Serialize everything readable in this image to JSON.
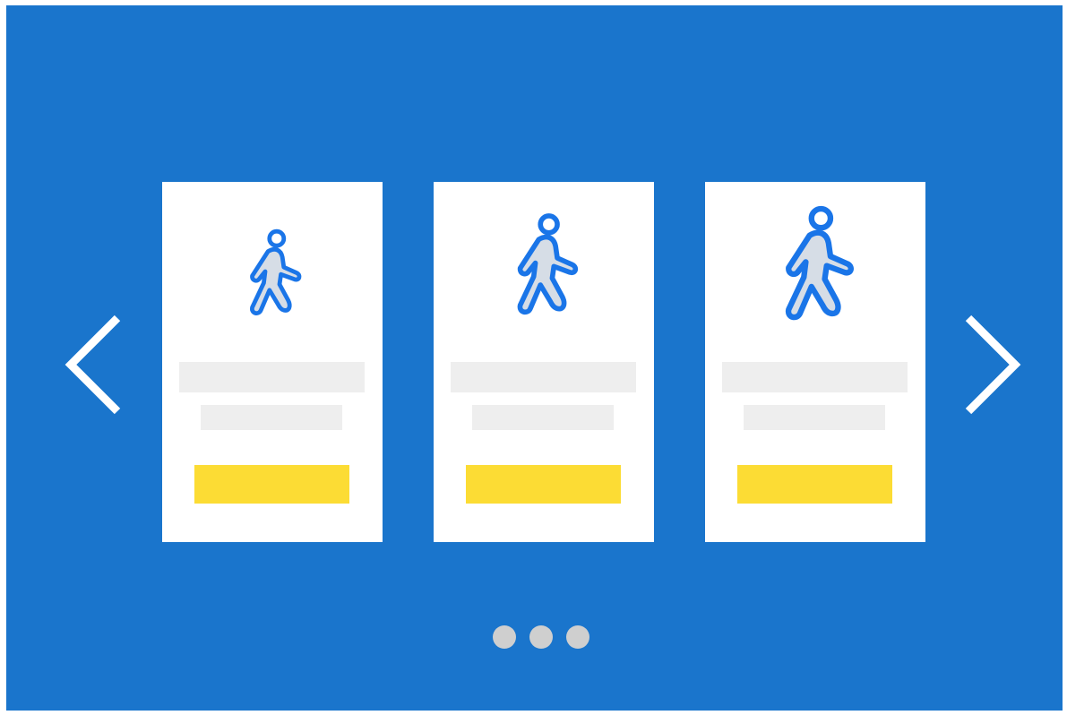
{
  "colors": {
    "background": "#1a75cc",
    "card": "#ffffff",
    "placeholder_bar": "#eeeeee",
    "cta": "#fcdc34",
    "dot": "#cfcfcf",
    "arrow": "#ffffff",
    "icon_stroke": "#1a75e8"
  },
  "carousel": {
    "prev_icon": "chevron-left-icon",
    "next_icon": "chevron-right-icon",
    "cards": [
      {
        "icon": "walking-person-icon"
      },
      {
        "icon": "walking-person-icon"
      },
      {
        "icon": "walking-person-icon"
      }
    ],
    "pagination": {
      "count": 3
    }
  }
}
